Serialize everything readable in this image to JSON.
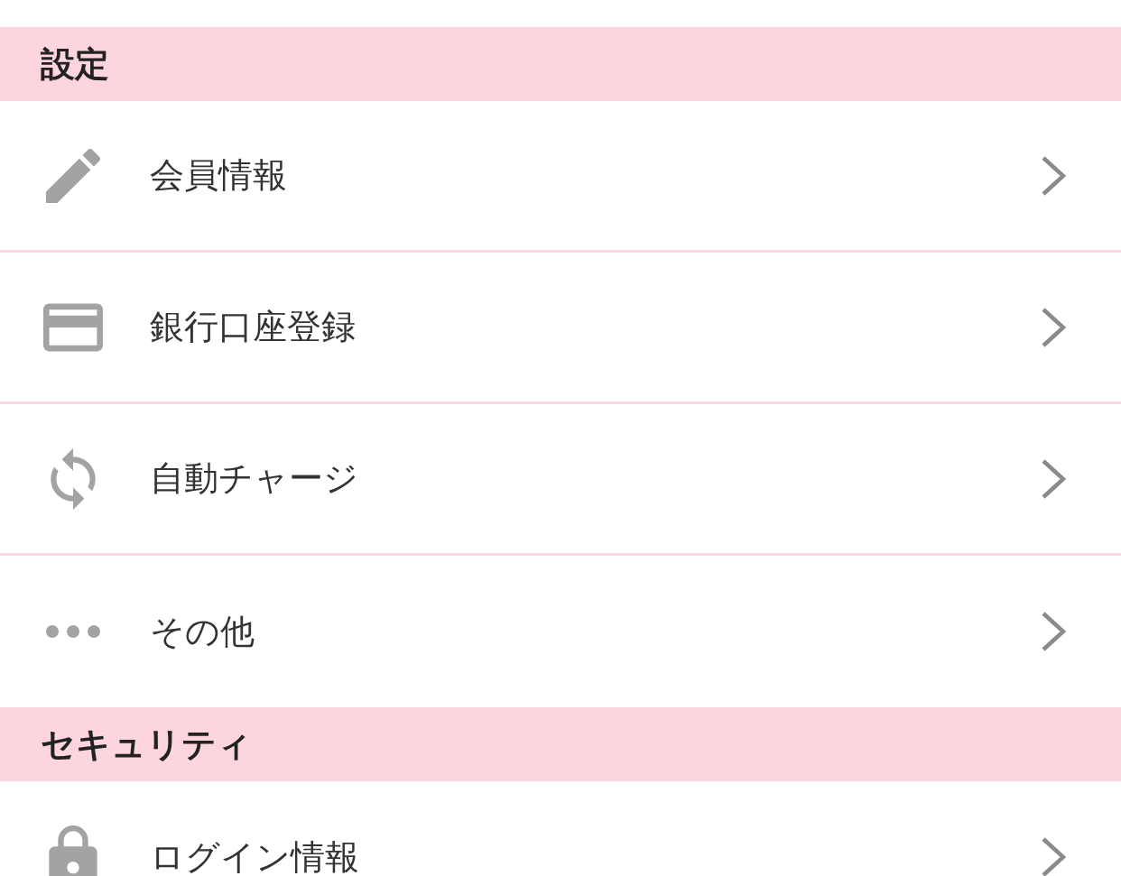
{
  "sections": [
    {
      "title": "設定",
      "items": [
        {
          "label": "会員情報"
        },
        {
          "label": "銀行口座登録"
        },
        {
          "label": "自動チャージ"
        },
        {
          "label": "その他"
        }
      ]
    },
    {
      "title": "セキュリティ",
      "items": [
        {
          "label": "ログイン情報"
        }
      ]
    }
  ]
}
